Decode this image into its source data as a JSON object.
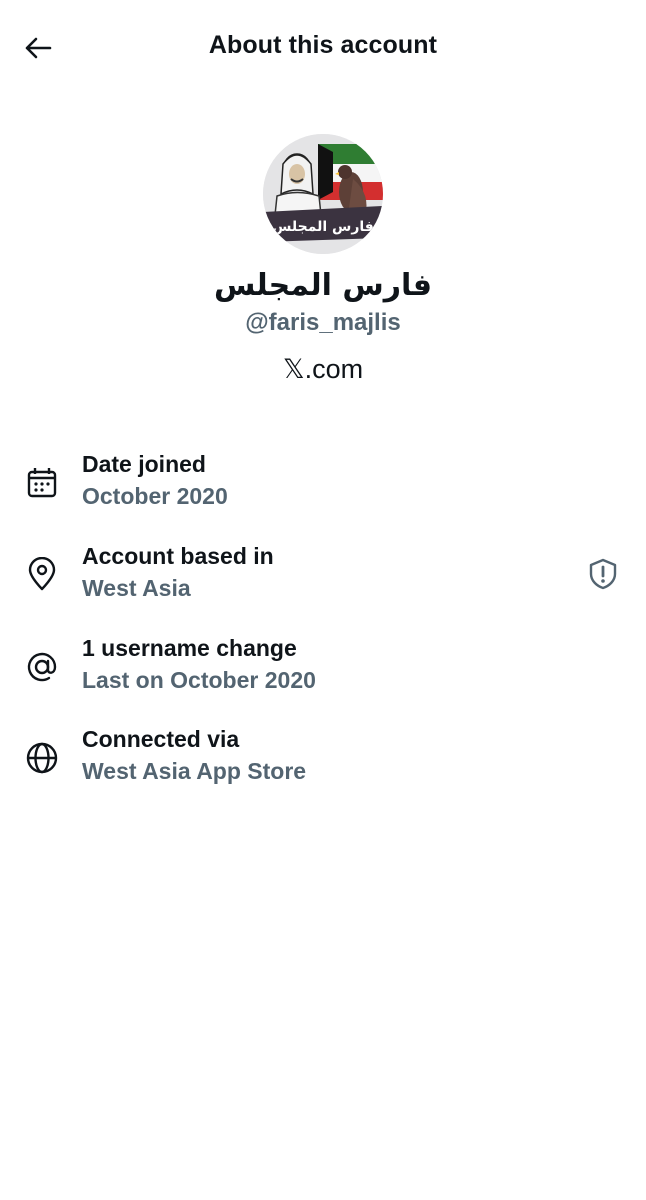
{
  "header": {
    "title": "About this account",
    "back_icon": "arrow-left-icon"
  },
  "profile": {
    "display_name": "فارس المجلس",
    "handle": "@faris_majlis",
    "site": "𝕏.com",
    "avatar_text": "فارس المجلس"
  },
  "details": [
    {
      "icon": "calendar-icon",
      "label": "Date joined",
      "value": "October 2020"
    },
    {
      "icon": "location-pin-icon",
      "label": "Account based in",
      "value": "West Asia"
    },
    {
      "icon": "at-sign-icon",
      "label": "1 username change",
      "value": "Last on October 2020"
    },
    {
      "icon": "globe-icon",
      "label": "Connected via",
      "value": "West Asia App Store"
    }
  ],
  "colors": {
    "text": "#0f1419",
    "secondary": "#536471",
    "background": "#ffffff"
  }
}
